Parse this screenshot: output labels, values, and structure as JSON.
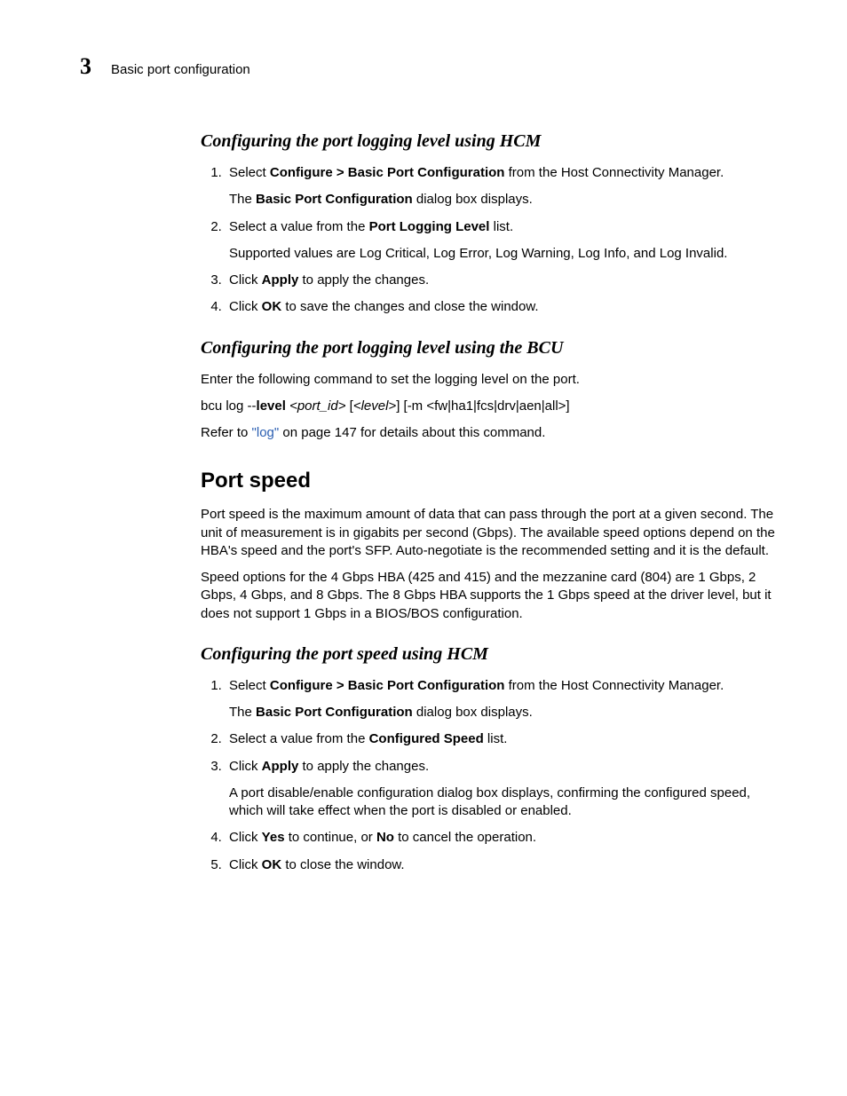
{
  "header": {
    "chapter_number": "3",
    "chapter_title": "Basic port configuration"
  },
  "section1": {
    "heading": "Configuring the port logging level using HCM",
    "steps": [
      {
        "pre": "Select ",
        "bold": "Configure > Basic Port Configuration",
        "post": " from the Host Connectivity Manager.",
        "sub_pre": "The ",
        "sub_bold": "Basic Port Configuration",
        "sub_post": " dialog box displays."
      },
      {
        "pre": "Select a value from the ",
        "bold": "Port Logging Level",
        "post": " list.",
        "sub_plain": "Supported values are Log Critical, Log Error, Log Warning, Log Info, and Log Invalid."
      },
      {
        "pre": "Click ",
        "bold": "Apply",
        "post": " to apply the changes."
      },
      {
        "pre": "Click ",
        "bold": "OK",
        "post": " to save the changes and close the window."
      }
    ]
  },
  "section2": {
    "heading": "Configuring the port logging level using the BCU",
    "intro": "Enter the following command to set the logging level on the port.",
    "cmd_plain1": "bcu log --",
    "cmd_bold": "level",
    "cmd_space": " ",
    "cmd_ital1": "<port_id>",
    "cmd_plain2": " [",
    "cmd_ital2": "<level>",
    "cmd_plain3": "] [-m <fw|ha1|fcs|drv|aen|all>]",
    "ref_pre": "Refer to ",
    "ref_link": "\"log\"",
    "ref_post": " on page 147 for details about this command."
  },
  "section3": {
    "heading": "Port speed",
    "p1": "Port speed is the maximum amount of data that can pass through the port at a given second. The unit of measurement is in gigabits per second (Gbps). The available speed options depend on the HBA's speed and the port's SFP. Auto-negotiate is the recommended setting and it is the default.",
    "p2": "Speed options for the 4 Gbps HBA (425 and 415) and the mezzanine card (804) are 1 Gbps, 2 Gbps, 4 Gbps, and 8 Gbps. The 8 Gbps HBA supports the 1 Gbps speed at the driver level, but it does not support 1 Gbps in a BIOS/BOS configuration."
  },
  "section4": {
    "heading": "Configuring the port speed using HCM",
    "steps": [
      {
        "pre": "Select ",
        "bold": "Configure > Basic Port Configuration",
        "post": " from the Host Connectivity Manager.",
        "sub_pre": "The ",
        "sub_bold": "Basic Port Configuration",
        "sub_post": " dialog box displays."
      },
      {
        "pre": "Select a value from the ",
        "bold": "Configured Speed",
        "post": " list."
      },
      {
        "pre": "Click ",
        "bold": "Apply",
        "post": " to apply the changes.",
        "sub_plain": "A port disable/enable configuration dialog box displays, confirming the configured speed, which will take effect when the port is disabled or enabled."
      },
      {
        "pre": "Click ",
        "bold": "Yes",
        "post": " to continue, or ",
        "bold2": "No",
        "post2": " to cancel the operation."
      },
      {
        "pre": "Click ",
        "bold": "OK",
        "post": " to close the window."
      }
    ]
  }
}
